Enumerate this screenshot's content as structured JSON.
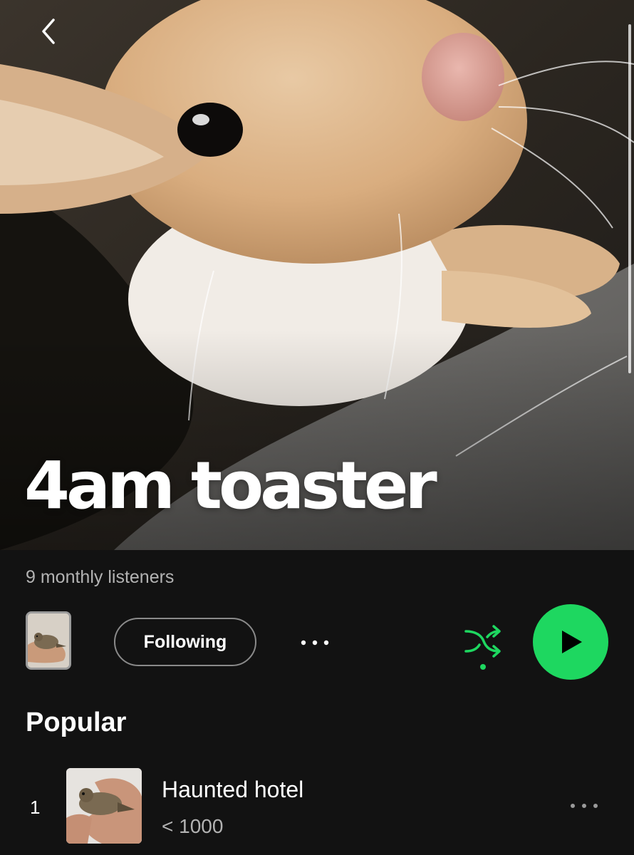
{
  "artist": {
    "name": "4am toaster",
    "monthly_listeners": "9 monthly listeners",
    "hero_image": "rabbit-photo"
  },
  "nav": {
    "back_icon": "chevron-left-icon"
  },
  "actions": {
    "follow_label": "Following",
    "more_icon": "more-horizontal-icon",
    "shuffle_icon": "shuffle-icon",
    "shuffle_enabled": true,
    "play_icon": "play-icon"
  },
  "popular": {
    "title": "Popular",
    "tracks": [
      {
        "index": "1",
        "title": "Haunted hotel",
        "plays": "< 1000",
        "cover": "bird-in-hand-photo"
      }
    ]
  },
  "colors": {
    "background": "#121212",
    "accent_green": "#1ed760",
    "secondary_text": "#b3b3b3"
  }
}
